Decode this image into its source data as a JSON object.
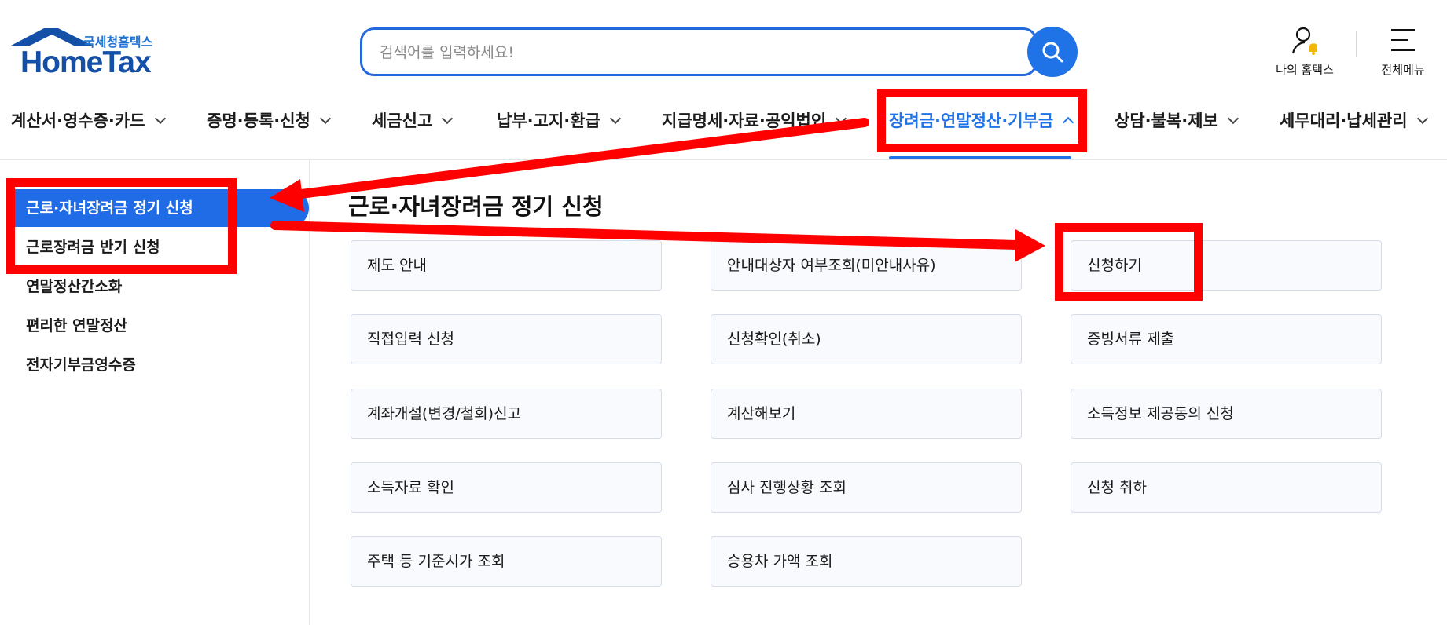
{
  "header": {
    "logo_sub": "국세청홈택스",
    "logo_main": "HomeTax",
    "search": {
      "placeholder": "검색어를 입력하세요!",
      "value": ""
    },
    "my_hometax_label": "나의 홈택스",
    "all_menu_label": "전체메뉴"
  },
  "nav": {
    "items": [
      {
        "label": "계산서·영수증·카드"
      },
      {
        "label": "증명·등록·신청"
      },
      {
        "label": "세금신고"
      },
      {
        "label": "납부·고지·환급"
      },
      {
        "label": "지급명세·자료·공익법인"
      },
      {
        "label": "장려금·연말정산·기부금",
        "active": true
      },
      {
        "label": "상담·불복·제보"
      },
      {
        "label": "세무대리·납세관리"
      }
    ]
  },
  "sidebar": {
    "items": [
      {
        "label": "근로·자녀장려금 정기 신청",
        "active": true
      },
      {
        "label": "근로장려금 반기 신청"
      },
      {
        "label": "연말정산간소화"
      },
      {
        "label": "편리한 연말정산"
      },
      {
        "label": "전자기부금영수증"
      }
    ]
  },
  "main": {
    "title": "근로·자녀장려금 정기 신청",
    "cards": [
      "제도 안내",
      "안내대상자 여부조회(미안내사유)",
      "신청하기",
      "직접입력 신청",
      "신청확인(취소)",
      "증빙서류 제출",
      "계좌개설(변경/철회)신고",
      "계산해보기",
      "소득정보 제공동의 신청",
      "소득자료 확인",
      "심사 진행상황 조회",
      "신청 취하",
      "주택 등 기준시가 조회",
      "승용차 가액 조회"
    ]
  },
  "colors": {
    "accent": "#1f73e6",
    "brand": "#1550a8",
    "annotation": "#ff0000"
  }
}
